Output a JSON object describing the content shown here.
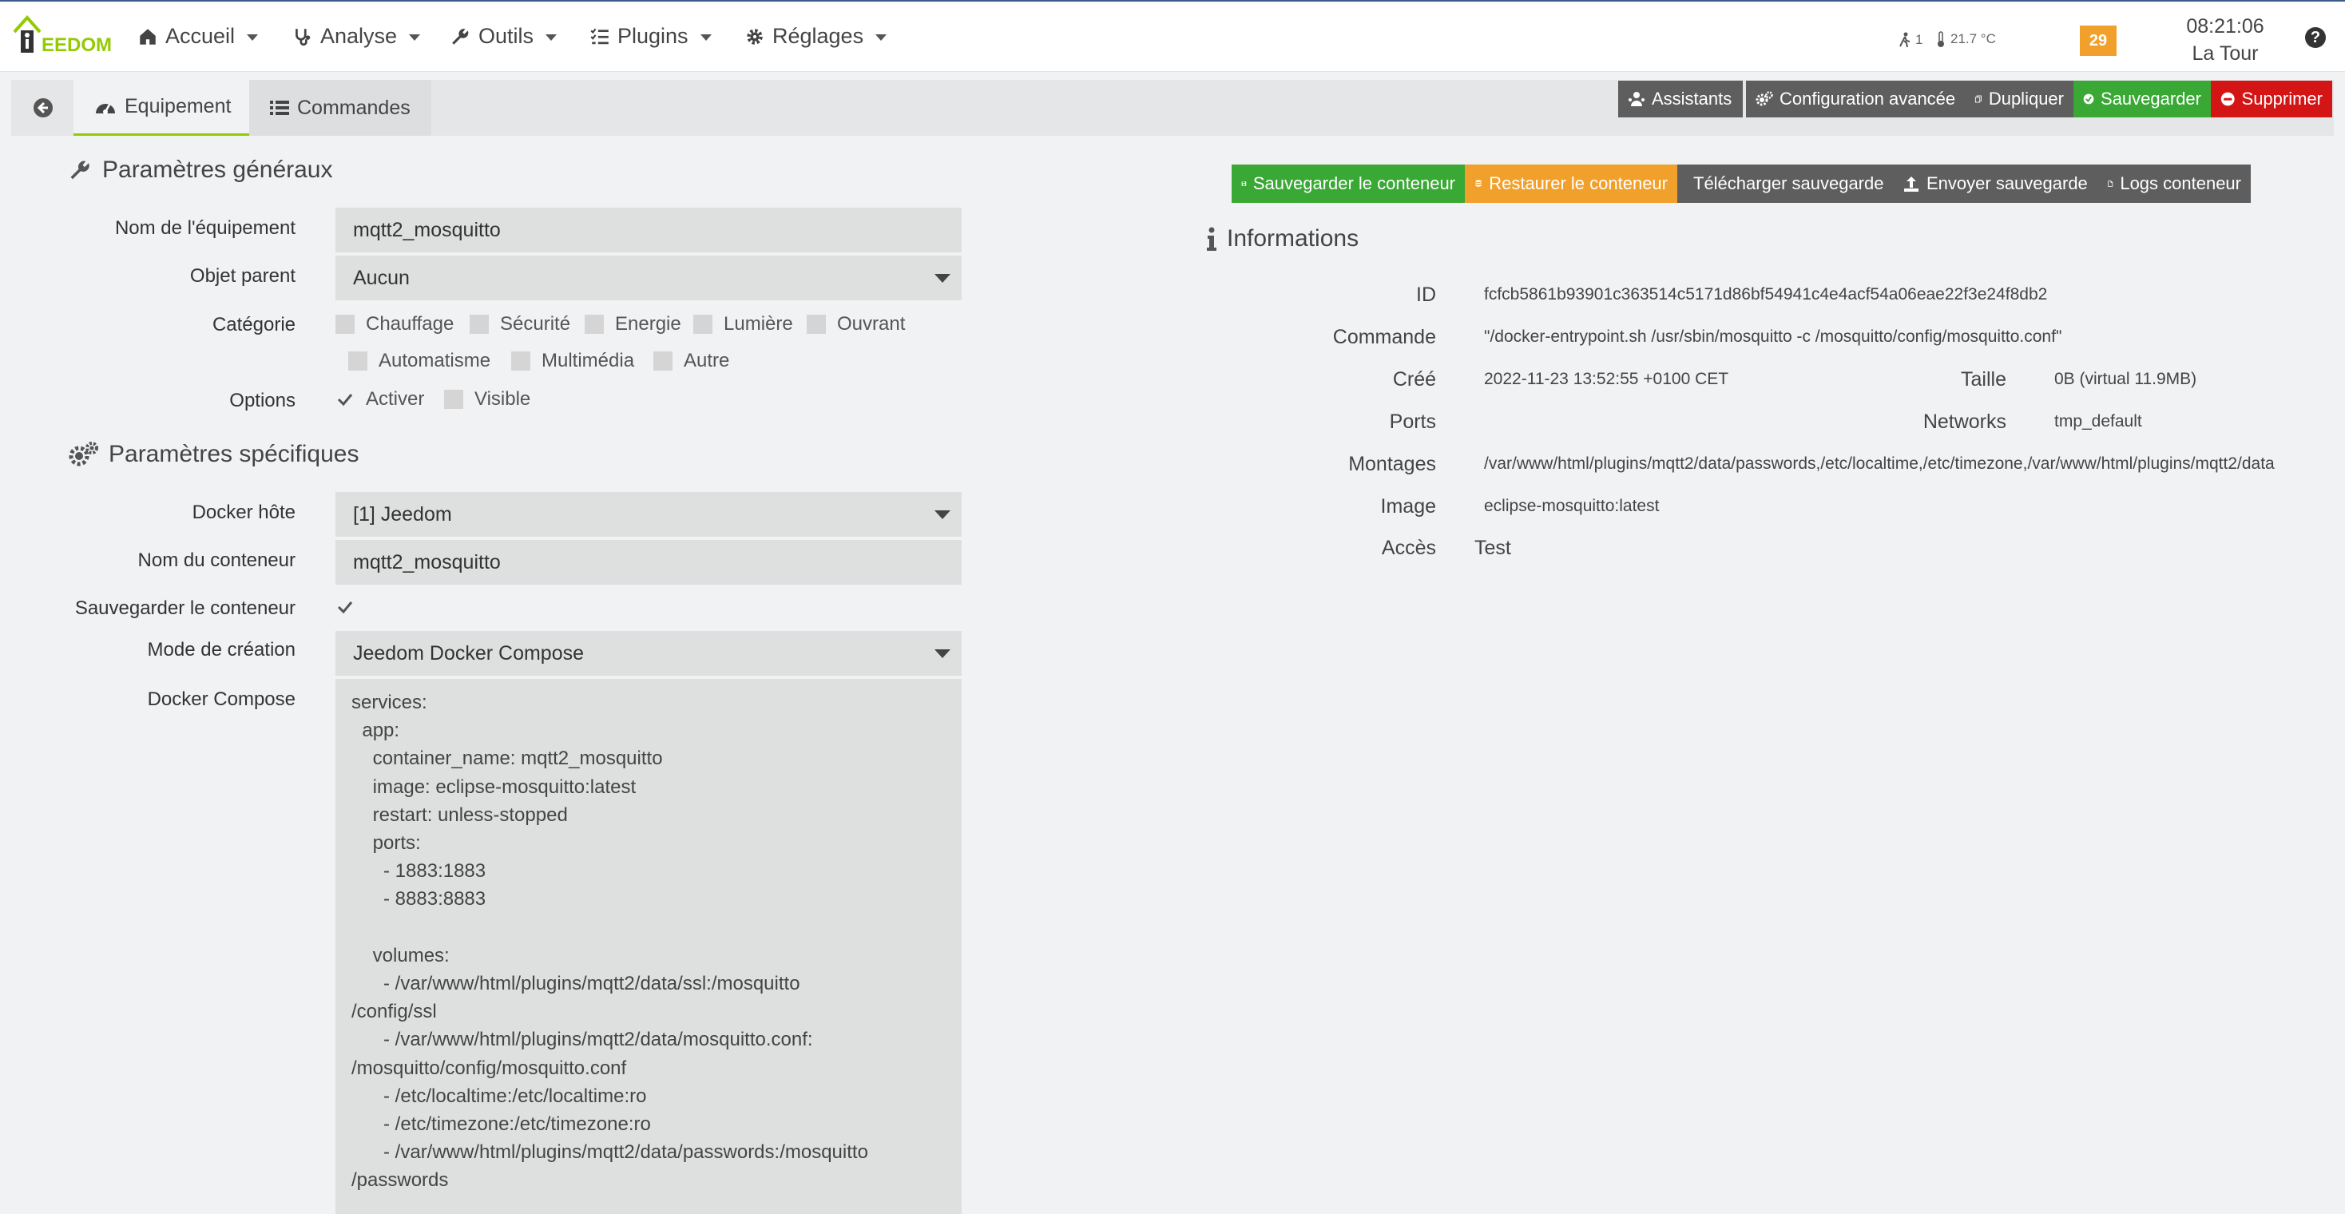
{
  "logo_text": "EEDOM",
  "nav": {
    "accueil": "Accueil",
    "analyse": "Analyse",
    "outils": "Outils",
    "plugins": "Plugins",
    "reglages": "Réglages"
  },
  "status": {
    "presence": "1",
    "temperature": "21.7 °C",
    "messages": "29",
    "time": "08:21:06",
    "location": "La Tour"
  },
  "tabs": {
    "equipement": "Equipement",
    "commandes": "Commandes"
  },
  "actions": {
    "assistants": "Assistants",
    "config_avancee": "Configuration avancée",
    "dupliquer": "Dupliquer",
    "sauvegarder": "Sauvegarder",
    "supprimer": "Supprimer"
  },
  "general": {
    "title": "Paramètres généraux",
    "name_label": "Nom de l'équipement",
    "name_value": "mqtt2_mosquitto",
    "parent_label": "Objet parent",
    "parent_value": "Aucun",
    "category_label": "Catégorie",
    "categories": [
      "Chauffage",
      "Sécurité",
      "Energie",
      "Lumière",
      "Ouvrant",
      "Automatisme",
      "Multimédia",
      "Autre"
    ],
    "options_label": "Options",
    "option_activer": "Activer",
    "option_visible": "Visible"
  },
  "specific": {
    "title": "Paramètres spécifiques",
    "host_label": "Docker hôte",
    "host_value": "[1] Jeedom",
    "container_label": "Nom du conteneur",
    "container_value": "mqtt2_mosquitto",
    "save_label": "Sauvegarder le conteneur",
    "mode_label": "Mode de création",
    "mode_value": "Jeedom Docker Compose",
    "compose_label": "Docker Compose",
    "compose_value": "services:\n  app:\n    container_name: mqtt2_mosquitto\n    image: eclipse-mosquitto:latest\n    restart: unless-stopped\n    ports:\n      - 1883:1883\n      - 8883:8883\n\n    volumes:\n      - /var/www/html/plugins/mqtt2/data/ssl:/mosquitto\n/config/ssl\n      - /var/www/html/plugins/mqtt2/data/mosquitto.conf:\n/mosquitto/config/mosquitto.conf\n      - /etc/localtime:/etc/localtime:ro\n      - /etc/timezone:/etc/timezone:ro\n      - /var/www/html/plugins/mqtt2/data/passwords:/mosquitto\n/passwords"
  },
  "container_actions": {
    "save": "Sauvegarder le conteneur",
    "restore": "Restaurer le conteneur",
    "download": "Télécharger sauvegarde",
    "upload": "Envoyer sauvegarde",
    "logs": "Logs conteneur"
  },
  "info": {
    "title": "Informations",
    "id_label": "ID",
    "id_value": "fcfcb5861b93901c363514c5171d86bf54941c4e4acf54a06eae22f3e24f8db2",
    "command_label": "Commande",
    "command_value": "\"/docker-entrypoint.sh /usr/sbin/mosquitto -c /mosquitto/config/mosquitto.conf\"",
    "created_label": "Créé",
    "created_value": "2022-11-23 13:52:55 +0100 CET",
    "size_label": "Taille",
    "size_value": "0B (virtual 11.9MB)",
    "ports_label": "Ports",
    "ports_value": "",
    "networks_label": "Networks",
    "networks_value": "tmp_default",
    "mounts_label": "Montages",
    "mounts_value": "/var/www/html/plugins/mqtt2/data/passwords,/etc/localtime,/etc/timezone,/var/www/html/plugins/mqtt2/data",
    "image_label": "Image",
    "image_value": "eclipse-mosquitto:latest",
    "access_label": "Accès",
    "access_value": "Test"
  },
  "colors": {
    "green": "#3aa835",
    "red": "#d41515",
    "orange": "#f2a02c",
    "dark": "#5e5e5e",
    "accent": "#94ca02"
  }
}
